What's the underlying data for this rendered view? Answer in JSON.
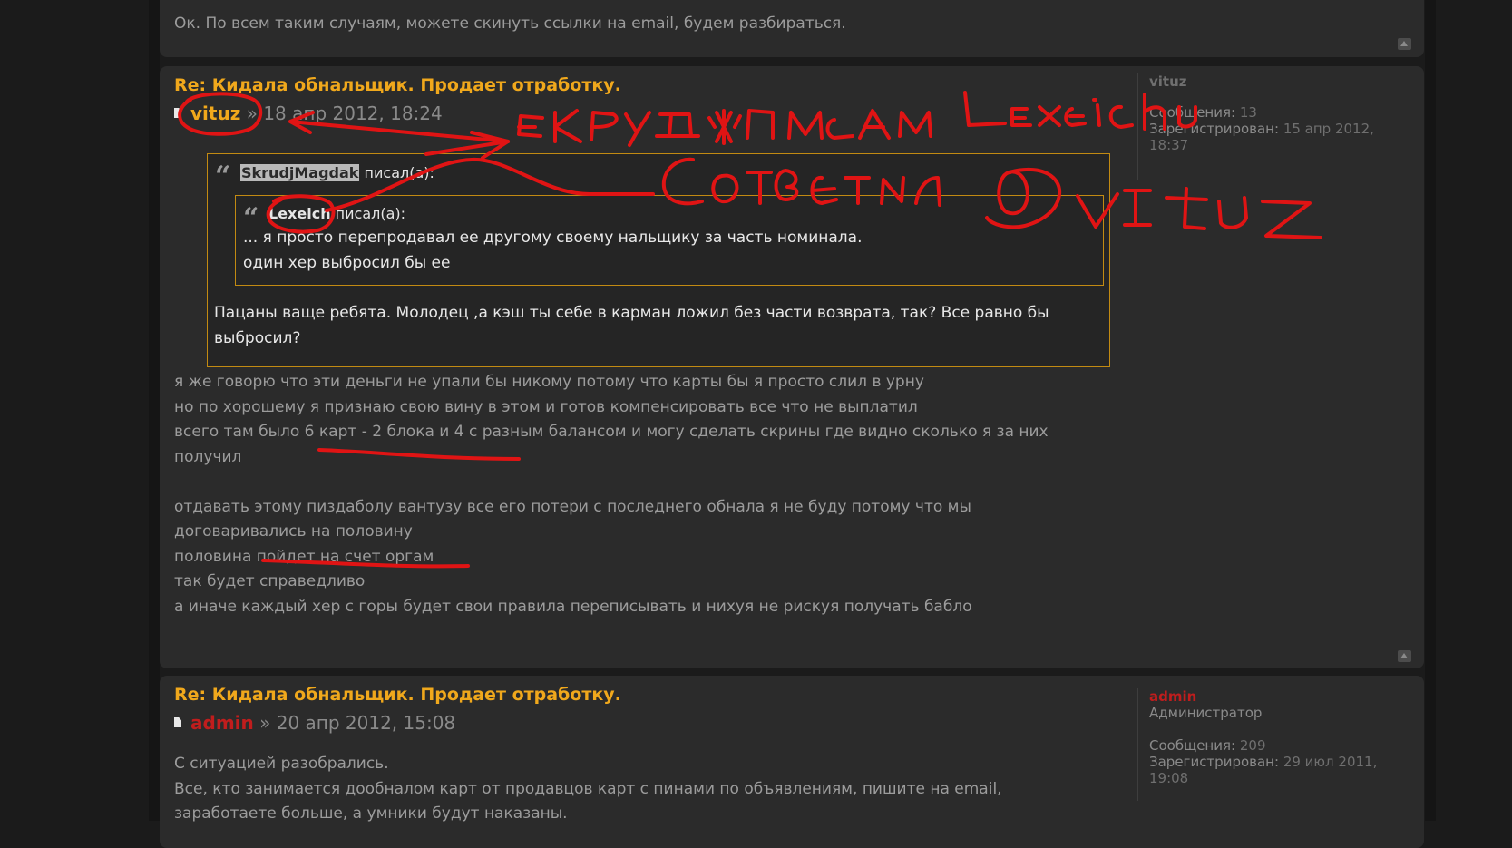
{
  "top_post": {
    "text": "Ок. По всем таким случаям, можете скинуть ссылки на email, будем разбираться."
  },
  "post1": {
    "title": "Re: Кидала обнальщик. Продает отработку.",
    "author": "vituz",
    "separator": "»",
    "date": "18 апр 2012, 18:24",
    "quote": {
      "author": "SkrudjMagdak",
      "said": "писал(а):",
      "nested": {
        "author": "Lexeich",
        "said": "писал(а):",
        "lines": [
          "... я просто перепродавал ее другому своему нальщику за часть номинала.",
          "один хер выбросил бы ее"
        ]
      },
      "lines": [
        "Пацаны ваще ребята. Молодец ,а кэш ты себе в карман ложил без части возврата, так? Все равно бы",
        "выбросил?"
      ]
    },
    "body_lines": [
      "я же говорю что эти деньги не упали бы никому потому что карты бы я просто слил в урну",
      "но по хорошему я признаю свою вину в этом и готов компенсировать все что не выплатил",
      "всего там было 6 карт - 2 блока и 4 с разным балансом и могу сделать скрины где видно сколько я за них",
      "получил",
      "",
      "отдавать этому пиздаболу вантузу все его потери с последнего обнала я не буду потому что мы",
      "договаривались на половину",
      "половина пойдет на счет оргам",
      "так будет справедливо",
      "а иначе каждый хер с горы будет свои правила переписывать и нихуя не рискуя получать бабло"
    ],
    "profile": {
      "name": "vituz",
      "posts_label": "Сообщения:",
      "posts_value": "13",
      "registered_label": "Зарегистрирован:",
      "registered_value_1": "15 апр 2012,",
      "registered_value_2": "18:37"
    }
  },
  "post2": {
    "title": "Re: Кидала обнальщик. Продает отработку.",
    "author": "admin",
    "separator": "»",
    "date": "20 апр 2012, 15:08",
    "body_lines": [
      "С ситуацией разобрались.",
      "Все, кто занимается дообналом карт от продавцов карт с пинами по объявлениям, пишите на email,",
      "заработаете больше, а умники будут наказаны."
    ],
    "profile": {
      "name": "admin",
      "role": "Администратор",
      "posts_label": "Сообщения:",
      "posts_value": "209",
      "registered_label": "Зарегистрирован:",
      "registered_value_1": "29 июл 2011,",
      "registered_value_2": "19:08"
    }
  },
  "colors": {
    "title": "#f0a81c",
    "admin": "#c01d1d",
    "annotation": "#e01414",
    "quote_border": "#c28a12"
  },
  "icons": [
    "document-icon",
    "quote-mark-icon",
    "up-arrow-icon"
  ]
}
